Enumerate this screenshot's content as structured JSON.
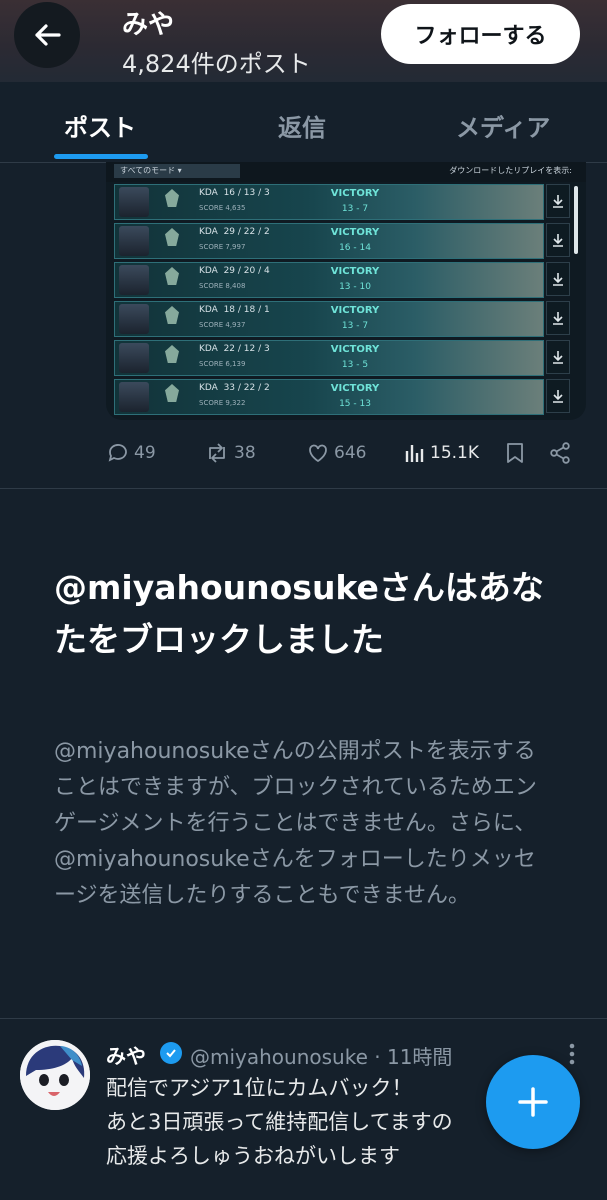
{
  "header": {
    "name": "みや",
    "post_count": "4,824件のポスト",
    "follow_label": "フォローする"
  },
  "tabs": [
    {
      "label": "ポスト",
      "active": true
    },
    {
      "label": "返信",
      "active": false
    },
    {
      "label": "メディア",
      "active": false
    }
  ],
  "media": {
    "mode_filter": "すべてのモード",
    "replay_label": "ダウンロードしたリプレイを表示:",
    "matches": [
      {
        "kda_label": "KDA",
        "kda": "16 / 13 / 3",
        "score_label": "SCORE",
        "score": "4,635",
        "outcome": "VICTORY",
        "result": "13 - 7"
      },
      {
        "kda_label": "KDA",
        "kda": "29 / 22 / 2",
        "score_label": "SCORE",
        "score": "7,997",
        "outcome": "VICTORY",
        "result": "16 - 14"
      },
      {
        "kda_label": "KDA",
        "kda": "29 / 20 / 4",
        "score_label": "SCORE",
        "score": "8,408",
        "outcome": "VICTORY",
        "result": "13 - 10"
      },
      {
        "kda_label": "KDA",
        "kda": "18 / 18 / 1",
        "score_label": "SCORE",
        "score": "4,937",
        "outcome": "VICTORY",
        "result": "13 - 7"
      },
      {
        "kda_label": "KDA",
        "kda": "22 / 12 / 3",
        "score_label": "SCORE",
        "score": "6,139",
        "outcome": "VICTORY",
        "result": "13 - 5"
      },
      {
        "kda_label": "KDA",
        "kda": "33 / 22 / 2",
        "score_label": "SCORE",
        "score": "9,322",
        "outcome": "VICTORY",
        "result": "15 - 13"
      }
    ]
  },
  "actions": {
    "replies": "49",
    "reposts": "38",
    "likes": "646",
    "views": "15.1K"
  },
  "block_notice": {
    "title": "@miyahounosukeさんはあなたをブロックしました",
    "body": "@miyahounosukeさんの公開ポストを表示することはできますが、ブロックされているためエンゲージメントを行うことはできません。さらに、@miyahounosukeさんをフォローしたりメッセージを送信したりすることもできません。"
  },
  "tweet": {
    "name": "みや",
    "handle_time": "@miyahounosuke · 11時間",
    "lines": [
      "配信でアジア1位にカムバック！",
      "あと3日頑張って維持配信してますの",
      "応援よろしゅうおねがいします"
    ]
  },
  "colors": {
    "background": "#15202b",
    "accent": "#1d9bf0",
    "muted_text": "#8b98a5"
  }
}
